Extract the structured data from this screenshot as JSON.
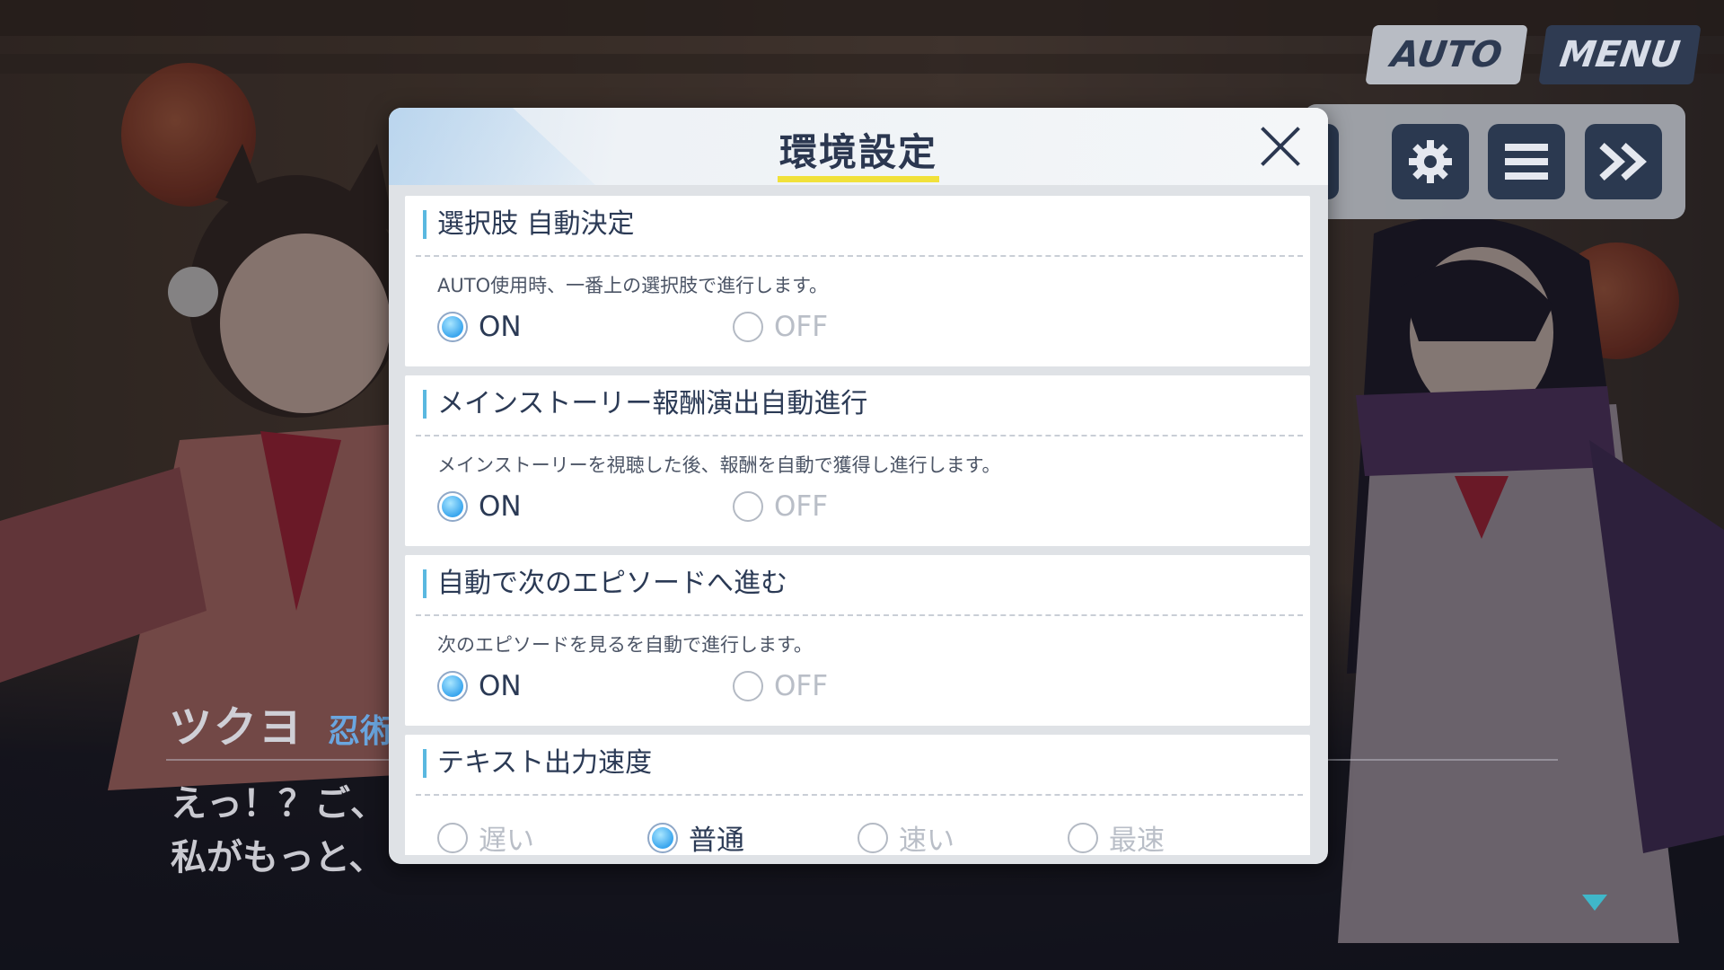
{
  "hud": {
    "auto_label": "AUTO",
    "menu_label": "MENU",
    "icons": [
      "expand-icon",
      "gear-icon",
      "log-list-icon",
      "fast-forward-icon"
    ]
  },
  "dialogue": {
    "speaker_name": "ツクヨ",
    "speaker_title": "忍術",
    "line1": "えっ！？ご、",
    "line2": "私がもっと、"
  },
  "dialog": {
    "title": "環境設定",
    "sections": [
      {
        "title": "選択肢 自動決定",
        "description": "AUTO使用時、一番上の選択肢で進行します。",
        "options": [
          {
            "label": "ON",
            "selected": true
          },
          {
            "label": "OFF",
            "selected": false
          }
        ]
      },
      {
        "title": "メインストーリー報酬演出自動進行",
        "description": "メインストーリーを視聴した後、報酬を自動で獲得し進行します。",
        "options": [
          {
            "label": "ON",
            "selected": true
          },
          {
            "label": "OFF",
            "selected": false
          }
        ]
      },
      {
        "title": "自動で次のエピソードへ進む",
        "description": "次のエピソードを見るを自動で進行します。",
        "options": [
          {
            "label": "ON",
            "selected": true
          },
          {
            "label": "OFF",
            "selected": false
          }
        ]
      },
      {
        "title": "テキスト出力速度",
        "options": [
          {
            "label": "遅い",
            "selected": false
          },
          {
            "label": "普通",
            "selected": true
          },
          {
            "label": "速い",
            "selected": false
          },
          {
            "label": "最速",
            "selected": false
          }
        ]
      }
    ]
  },
  "colors": {
    "accent_blue": "#3aa6ee",
    "title_underline": "#f1e13a",
    "navy": "#2b3750"
  }
}
